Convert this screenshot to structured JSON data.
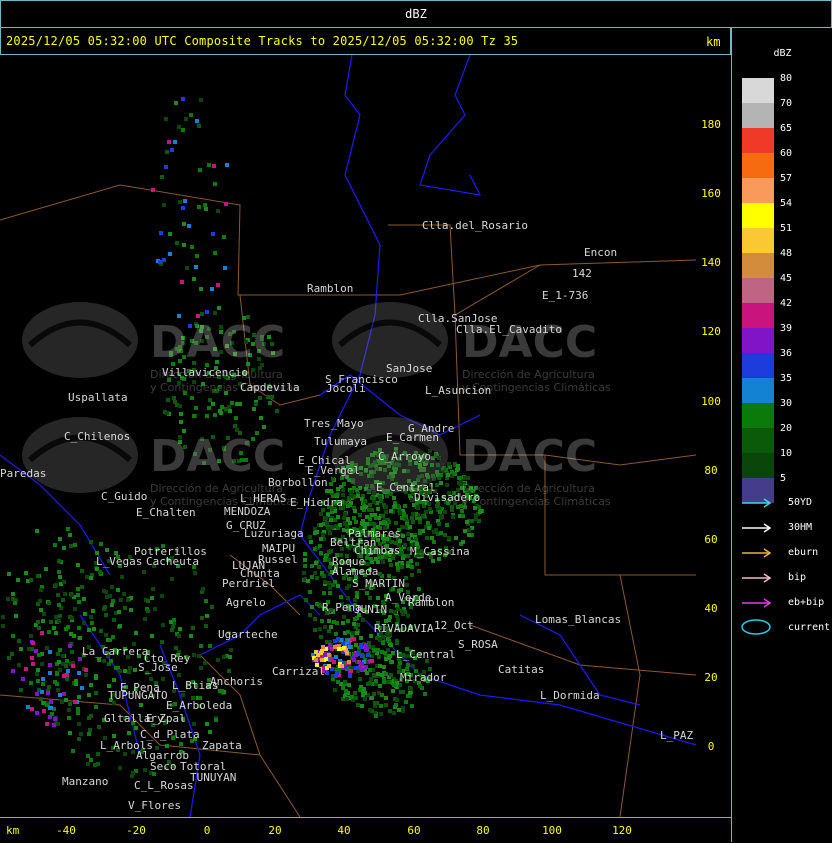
{
  "window": {
    "title": "dBZ"
  },
  "header": {
    "text": "2025/12/05 05:32:00 UTC Composite Tracks to 2025/12/05 05:32:00 Tz 35",
    "unit": "km"
  },
  "axes": {
    "x_unit": "km",
    "x_ticks": [
      "-40",
      "-20",
      "0",
      "20",
      "40",
      "60",
      "80",
      "100",
      "120"
    ],
    "y_ticks": [
      "180",
      "160",
      "140",
      "120",
      "100",
      "80",
      "60",
      "40",
      "20",
      "0"
    ]
  },
  "legend": {
    "title": "dBZ",
    "levels": [
      {
        "label": "80",
        "color": "#d8d8d8"
      },
      {
        "label": "70",
        "color": "#b4b4b4"
      },
      {
        "label": "65",
        "color": "#f03a28"
      },
      {
        "label": "60",
        "color": "#f66a10"
      },
      {
        "label": "57",
        "color": "#f89a5a"
      },
      {
        "label": "54",
        "color": "#ffff00"
      },
      {
        "label": "51",
        "color": "#fac832"
      },
      {
        "label": "48",
        "color": "#d28c3c"
      },
      {
        "label": "45",
        "color": "#c06484"
      },
      {
        "label": "42",
        "color": "#c8147c"
      },
      {
        "label": "39",
        "color": "#8214c8"
      },
      {
        "label": "36",
        "color": "#1e3cdc"
      },
      {
        "label": "35",
        "color": "#1482d2"
      },
      {
        "label": "30",
        "color": "#0a7a0a"
      },
      {
        "label": "20",
        "color": "#0a5a0a"
      },
      {
        "label": "10",
        "color": "#0a460a"
      },
      {
        "label": "5",
        "color": "#463c8c"
      }
    ],
    "tracks": [
      {
        "label": "50YD",
        "color": "#40d8e0"
      },
      {
        "label": "30HM",
        "color": "#ffffff"
      },
      {
        "label": "eburn",
        "color": "#f0b040"
      },
      {
        "label": "bip",
        "color": "#f8b8c8"
      },
      {
        "label": "eb+bip",
        "color": "#e040e0"
      }
    ],
    "current": {
      "label": "current",
      "color": "#20d0e0"
    }
  },
  "places": [
    {
      "name": "Clla.del_Rosario"
    },
    {
      "name": "Encon"
    },
    {
      "name": "142"
    },
    {
      "name": "E_1-736"
    },
    {
      "name": "Ramblon"
    },
    {
      "name": "Clla.SanJose"
    },
    {
      "name": "Clla.El_Cavadito"
    },
    {
      "name": "Villavicencio"
    },
    {
      "name": "Capdevila"
    },
    {
      "name": "S_Francisco"
    },
    {
      "name": "Jocoli"
    },
    {
      "name": "SanJose"
    },
    {
      "name": "L_Asuncion"
    },
    {
      "name": "Uspallata"
    },
    {
      "name": "Tres_Mayo"
    },
    {
      "name": "G_Andre"
    },
    {
      "name": "C_Chilenos"
    },
    {
      "name": "Tulumaya"
    },
    {
      "name": "E_Carmen"
    },
    {
      "name": "C_Arroyo"
    },
    {
      "name": "Paredas"
    },
    {
      "name": "E_Chical"
    },
    {
      "name": "E_Vergel"
    },
    {
      "name": "Borbollon"
    },
    {
      "name": "E_Central"
    },
    {
      "name": "Divisadero"
    },
    {
      "name": "C_Guido"
    },
    {
      "name": "L_HERAS"
    },
    {
      "name": "E_Hiedra"
    },
    {
      "name": "E_Chalten"
    },
    {
      "name": "MENDOZA"
    },
    {
      "name": "G_CRUZ"
    },
    {
      "name": "Luzuriaga"
    },
    {
      "name": "Beltran"
    },
    {
      "name": "Palmares"
    },
    {
      "name": "Chimbas"
    },
    {
      "name": "M_Cassina"
    },
    {
      "name": "Potrerillos"
    },
    {
      "name": "L_Vegas"
    },
    {
      "name": "Cacheuta"
    },
    {
      "name": "MAIPU"
    },
    {
      "name": "Russel"
    },
    {
      "name": "LUJAN"
    },
    {
      "name": "Chunta"
    },
    {
      "name": "Roque"
    },
    {
      "name": "Perdriel"
    },
    {
      "name": "Alameda"
    },
    {
      "name": "S_MARTIN"
    },
    {
      "name": "Agrelo"
    },
    {
      "name": "A_Verde"
    },
    {
      "name": "Ramblon"
    },
    {
      "name": "R_Pena"
    },
    {
      "name": "JUNIN"
    },
    {
      "name": "Lomas_Blancas"
    },
    {
      "name": "12_Oct"
    },
    {
      "name": "Ugarteche"
    },
    {
      "name": "RIVADAVIA"
    },
    {
      "name": "S_ROSA"
    },
    {
      "name": "La_Carrera"
    },
    {
      "name": "Cto_Rey"
    },
    {
      "name": "S_Jose"
    },
    {
      "name": "Carrizal"
    },
    {
      "name": "L_Central"
    },
    {
      "name": "Catitas"
    },
    {
      "name": "E_Pena"
    },
    {
      "name": "L_Btias"
    },
    {
      "name": "Anchoris"
    },
    {
      "name": "Mirador"
    },
    {
      "name": "TUPUNGATO"
    },
    {
      "name": "L_Dormida"
    },
    {
      "name": "E_Arboleda"
    },
    {
      "name": "Gltallary"
    },
    {
      "name": "E_Zpal"
    },
    {
      "name": "C_d_Plata"
    },
    {
      "name": "L_PAZ"
    },
    {
      "name": "L_Arbols"
    },
    {
      "name": "Zapata"
    },
    {
      "name": "Algarrob"
    },
    {
      "name": "Seco"
    },
    {
      "name": "Totoral"
    },
    {
      "name": "TUNUYAN"
    },
    {
      "name": "Manzano"
    },
    {
      "name": "C_L_Rosas"
    },
    {
      "name": "V_Flores"
    }
  ],
  "watermark": {
    "brand": "DACC",
    "tagline_1": "Dirección de Agricultura",
    "tagline_2": "y Contingencias Climáticas"
  },
  "colors": {
    "border": "#6fb7c4",
    "axis_text": "#ffff00",
    "boundary_blue": "#1a1aff",
    "boundary_brown": "#8b5a2b",
    "roads": "#3a3aff"
  }
}
